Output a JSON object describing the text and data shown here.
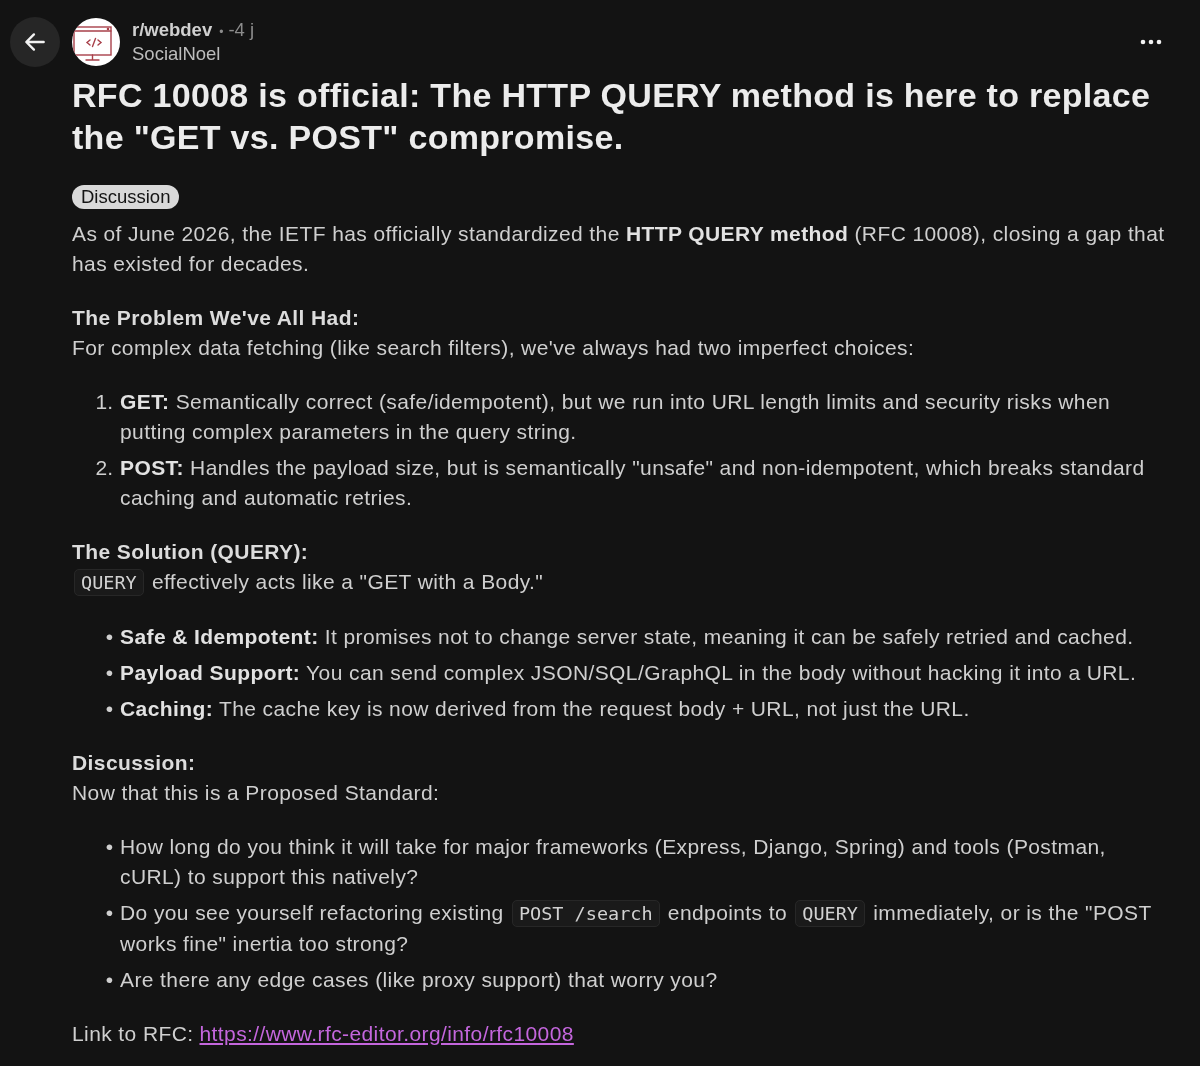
{
  "post": {
    "subreddit": "r/webdev",
    "separator": "•",
    "age": "-4 j",
    "author": "SocialNoel",
    "title": "RFC 10008 is official: The HTTP QUERY method is here to replace the \"GET vs. POST\" compromise.",
    "flair": "Discussion",
    "body": [
      {
        "kind": "paragraph",
        "parts": [
          {
            "kind": "text",
            "text": "As of June 2026, the IETF has officially standardized the **HTTP QUERY method** (RFC 10008), closing a gap that has existed for decades."
          }
        ]
      },
      {
        "kind": "heading",
        "text": "The Problem We've All Had:"
      },
      {
        "kind": "paragraph",
        "parts": [
          {
            "kind": "text",
            "text": "For complex data fetching (like search filters), we've always had two imperfect choices:"
          }
        ]
      },
      {
        "kind": "list",
        "items": [
          {
            "marker": "1.",
            "parts": [
              {
                "kind": "text",
                "text": "**GET:** Semantically correct (safe/idempotent), but we run into URL length limits and security risks when putting complex parameters in the query string."
              }
            ]
          },
          {
            "marker": "2.",
            "parts": [
              {
                "kind": "text",
                "text": "**POST:** Handles the payload size, but is semantically \"unsafe\" and non-idempotent, which breaks standard caching and automatic retries."
              }
            ]
          }
        ]
      },
      {
        "kind": "heading",
        "text": "The Solution (QUERY):"
      },
      {
        "kind": "paragraph",
        "parts": [
          {
            "kind": "code",
            "text": "QUERY"
          },
          {
            "kind": "text",
            "text": " effectively acts like a \"GET with a Body.\""
          }
        ]
      },
      {
        "kind": "list",
        "items": [
          {
            "marker": "•",
            "parts": [
              {
                "kind": "text",
                "text": "**Safe & Idempotent:** It promises not to change server state, meaning it can be safely retried and cached."
              }
            ]
          },
          {
            "marker": "•",
            "parts": [
              {
                "kind": "text",
                "text": "**Payload Support:** You can send complex JSON/SQL/GraphQL in the body without hacking it into a URL."
              }
            ]
          },
          {
            "marker": "•",
            "parts": [
              {
                "kind": "text",
                "text": "**Caching:** The cache key is now derived from the request body + URL, not just the URL."
              }
            ]
          }
        ]
      },
      {
        "kind": "heading",
        "text": "Discussion:"
      },
      {
        "kind": "paragraph",
        "parts": [
          {
            "kind": "text",
            "text": "Now that this is a Proposed Standard:"
          }
        ]
      },
      {
        "kind": "list",
        "items": [
          {
            "marker": "•",
            "parts": [
              {
                "kind": "text",
                "text": "How long do you think it will take for major frameworks (Express, Django, Spring) and tools (Postman, cURL) to support this natively?"
              }
            ]
          },
          {
            "marker": "•",
            "parts": [
              {
                "kind": "text",
                "text": "Do you see yourself refactoring existing "
              },
              {
                "kind": "code",
                "text": "POST /search"
              },
              {
                "kind": "text",
                "text": " endpoints to "
              },
              {
                "kind": "code",
                "text": "QUERY"
              },
              {
                "kind": "text",
                "text": " immediately, or is the \"POST works fine\" inertia too strong?"
              }
            ]
          },
          {
            "marker": "•",
            "parts": [
              {
                "kind": "text",
                "text": "Are there any edge cases (like proxy support) that worry you?"
              }
            ]
          }
        ]
      },
      {
        "kind": "link_line",
        "label": "Link to RFC:",
        "link": "https://www.rfc-editor.org/info/rfc10008"
      }
    ]
  }
}
